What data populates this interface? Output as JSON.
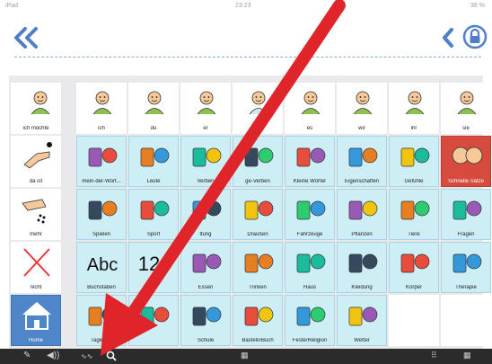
{
  "status_bar": {
    "carrier": "iPad",
    "time": "23:23",
    "battery": "38 %"
  },
  "toolbar": {
    "back_icon": "double-chevron-left-icon",
    "prev_icon": "chevron-left-icon",
    "lock_icon": "lock-icon"
  },
  "colors": {
    "accent": "#4f7fcb",
    "cell_blue": "#cdeef5",
    "cell_red": "#d64b3e",
    "home": "#4f86c9",
    "arrow": "#e0252a"
  },
  "grid": {
    "row1": [
      "ich möchte",
      "ich",
      "du",
      "er",
      "",
      "es",
      "wir",
      "ihr",
      "sie"
    ],
    "row2": [
      "da ist",
      "mein-der-Wört...",
      "Leute",
      "Verben",
      "ge-Verben",
      "Kleine Wörter",
      "Eigenschaften",
      "Gefühle",
      "Schnelle Sätze"
    ],
    "row3": [
      "mehr",
      "Spielen",
      "Sport",
      "ltung",
      "Draußen",
      "Fahrzeuge",
      "Pflanzen",
      "Tiere",
      "Fragen"
    ],
    "row4": [
      "nicht",
      "Buchstaben",
      "",
      "Essen",
      "Trinken",
      "Haus",
      "Kleidung",
      "Körper",
      "Therapie"
    ],
    "row5": [
      "Home",
      "Tagespla",
      "",
      "Schule",
      "Basteln/Buch",
      "Feste/Religion",
      "Wetter",
      "",
      ""
    ],
    "row4_symbols": {
      "letters": "Abc",
      "numbers": "12"
    }
  },
  "bottom_bar": {
    "icons": [
      "pencil-icon",
      "speaker-icon",
      "signal-icon",
      "search-icon",
      "grid-icon",
      "keyboard-icon",
      "page-grid-icon"
    ]
  }
}
